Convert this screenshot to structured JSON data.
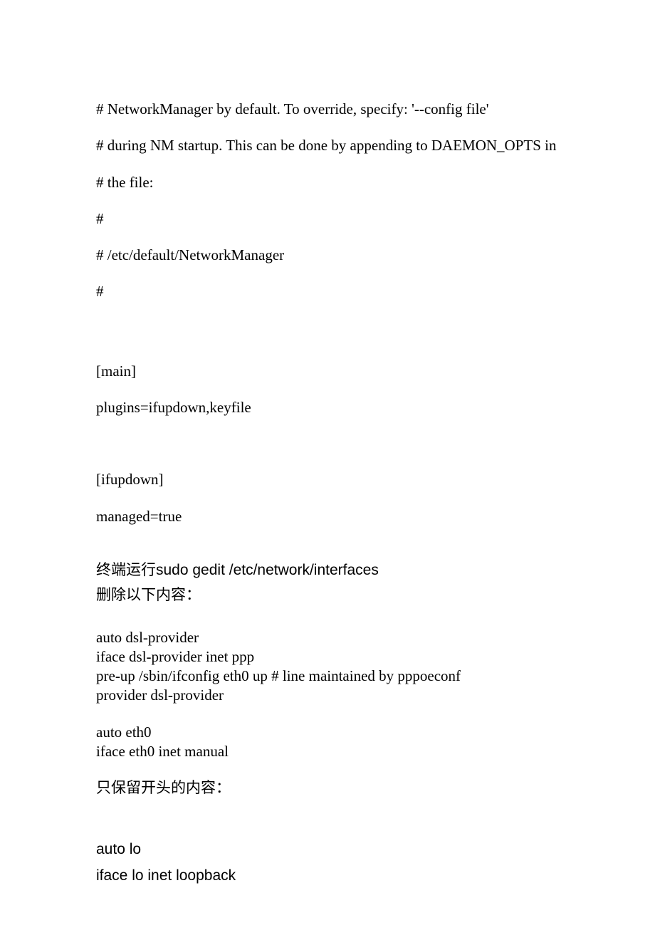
{
  "lines": {
    "l1": "# NetworkManager by default.  To override, specify: '--config file'",
    "l2": "# during NM startup.  This can be done by appending to DAEMON_OPTS in",
    "l3": "# the file:",
    "l4": "#",
    "l5": "# /etc/default/NetworkManager",
    "l6": "#",
    "l7": "[main]",
    "l8": "plugins=ifupdown,keyfile",
    "l9": "[ifupdown]",
    "l10": "managed=true",
    "l11_cn": "终端运行",
    "l11_cmd": "sudo gedit /etc/network/interfaces",
    "l12": "删除以下内容：",
    "b1_1": "auto dsl-provider",
    "b1_2": "iface dsl-provider inet ppp",
    "b1_3": "pre-up /sbin/ifconfig eth0 up # line maintained by pppoeconf",
    "b1_4": "provider dsl-provider",
    "b2_1": "auto eth0",
    "b2_2": "iface eth0 inet manual",
    "l13": "只保留开头的内容：",
    "l14": "auto lo",
    "l15": "iface lo inet loopback"
  }
}
